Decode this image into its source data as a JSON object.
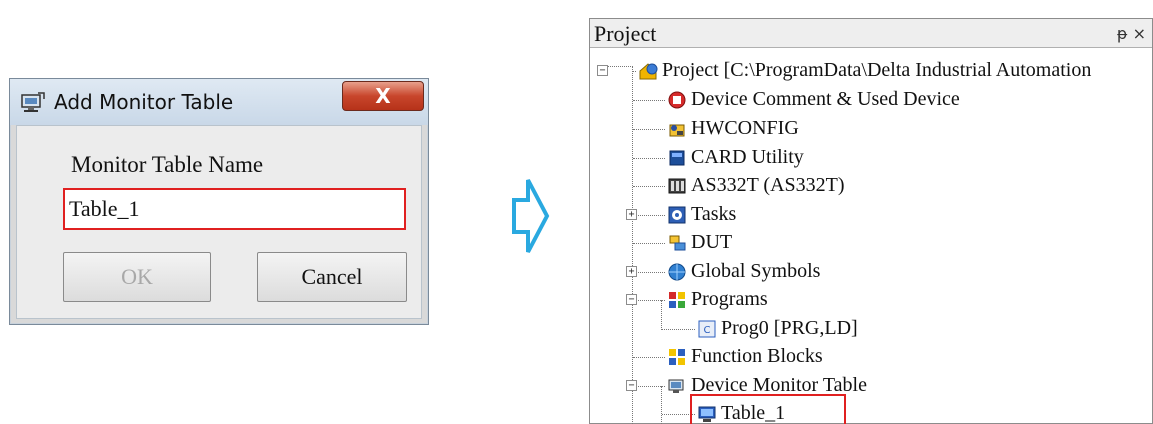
{
  "dialog": {
    "title": "Add Monitor Table",
    "close_label": "X",
    "field_label": "Monitor Table Name",
    "field_value": "Table_1",
    "ok_label": "OK",
    "cancel_label": "Cancel"
  },
  "pane": {
    "title": "Project",
    "pin_label": "ᵽ ×",
    "tree": [
      {
        "label": "Project [C:\\ProgramData\\Delta Industrial Automation",
        "icon": "project-icon"
      },
      {
        "label": "Device Comment & Used Device",
        "icon": "device-comment-icon"
      },
      {
        "label": "HWCONFIG",
        "icon": "hwconfig-icon"
      },
      {
        "label": "CARD Utility",
        "icon": "card-icon"
      },
      {
        "label": "AS332T  (AS332T)",
        "icon": "plc-icon"
      },
      {
        "label": "Tasks",
        "icon": "tasks-icon"
      },
      {
        "label": "DUT",
        "icon": "dut-icon"
      },
      {
        "label": "Global Symbols",
        "icon": "global-symbols-icon"
      },
      {
        "label": "Programs",
        "icon": "programs-icon"
      },
      {
        "label": "Prog0 [PRG,LD]",
        "icon": "program-icon"
      },
      {
        "label": "Function Blocks",
        "icon": "function-blocks-icon"
      },
      {
        "label": "Device Monitor Table",
        "icon": "monitor-table-icon"
      },
      {
        "label": "Table_1",
        "icon": "monitor-icon"
      }
    ]
  },
  "colors": {
    "highlight": "#e02020",
    "arrow_fill": "#ffffff",
    "arrow_stroke": "#2aa9e0"
  }
}
